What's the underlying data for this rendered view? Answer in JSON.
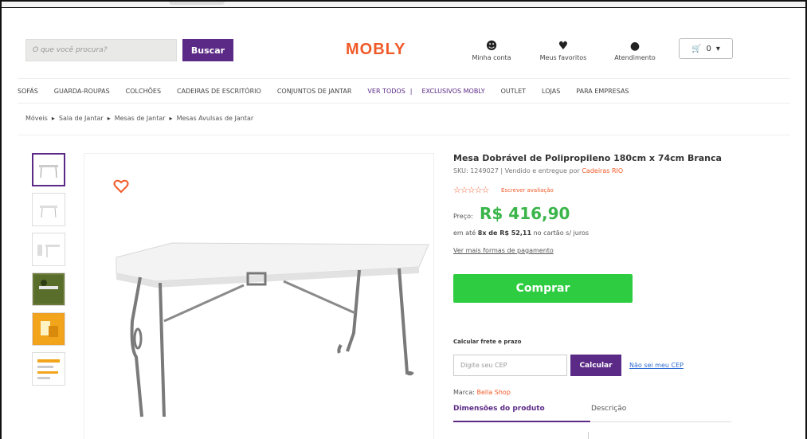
{
  "header": {
    "search_placeholder": "O que você procura?",
    "search_button": "Buscar",
    "logo": "MOBLY",
    "account_label": "Minha conta",
    "favorites_label": "Meus favoritos",
    "support_label": "Atendimento",
    "cart_count": "0"
  },
  "nav": {
    "items": [
      "SOFÁS",
      "GUARDA-ROUPAS",
      "COLCHÕES",
      "CADEIRAS DE ESCRITÓRIO",
      "CONJUNTOS DE JANTAR",
      "VER TODOS",
      "EXCLUSIVOS MOBLY",
      "OUTLET",
      "LOJAS",
      "PARA EMPRESAS"
    ]
  },
  "breadcrumb": [
    "Móveis",
    "Sala de Jantar",
    "Mesas de Jantar",
    "Mesas Avulsas de Jantar"
  ],
  "product": {
    "title": "Mesa Dobrável de Polipropileno 180cm x 74cm Branca",
    "sku_text": "SKU: 1249027 | Vendido e entregue por ",
    "seller": "Cadeiras RIO",
    "review_link": "Escrever avaliação",
    "price_label": "Preço:",
    "price": "R$ 416,90",
    "installments_prefix": "em até ",
    "installments_bold": "8x de R$ 52,11",
    "installments_suffix": " no cartão s/ juros",
    "more_payment": "Ver mais formas de pagamento",
    "buy_button": "Comprar",
    "shipping_label": "Calcular frete e prazo",
    "cep_placeholder": "Digite seu CEP",
    "calc_button": "Calcular",
    "dont_know_cep": "Não sei meu CEP",
    "brand_label": "Marca: ",
    "brand": "Bella Shop",
    "tab_dimensions": "Dimensões do produto",
    "tab_description": "Descrição"
  },
  "colors": {
    "brand_orange": "#f05a28",
    "purple": "#5b2a86",
    "price_green": "#3ab54a",
    "buy_green": "#2ecc40"
  }
}
